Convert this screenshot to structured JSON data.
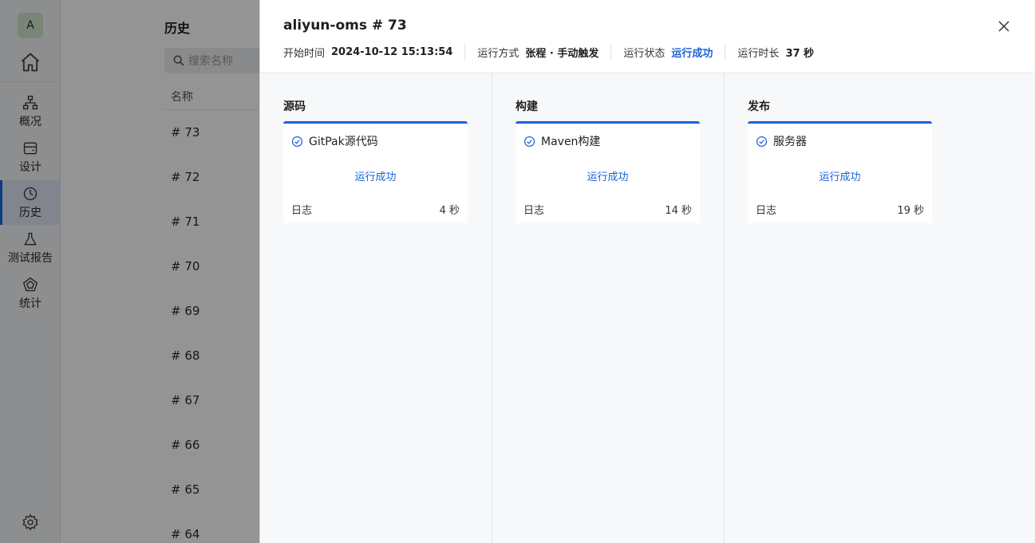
{
  "nav": {
    "avatar": "A",
    "items": [
      {
        "label": "概况",
        "icon": "sitemap-icon"
      },
      {
        "label": "设计",
        "icon": "card-icon"
      },
      {
        "label": "历史",
        "icon": "clock-icon"
      },
      {
        "label": "测试报告",
        "icon": "flask-icon"
      },
      {
        "label": "统计",
        "icon": "pentagon-icon"
      }
    ]
  },
  "list": {
    "title": "历史",
    "search_placeholder": "搜索名称",
    "column": "名称",
    "rows": [
      "# 73",
      "# 72",
      "# 71",
      "# 70",
      "# 69",
      "# 68",
      "# 67",
      "# 66",
      "# 65",
      "# 64"
    ]
  },
  "drawer": {
    "title": "aliyun-oms # 73",
    "meta": {
      "start_label": "开始时间",
      "start_value": "2024-10-12 15:13:54",
      "mode_label": "运行方式",
      "mode_value": "张程 · 手动触发",
      "status_label": "运行状态",
      "status_value": "运行成功",
      "duration_label": "运行时长",
      "duration_value": "37 秒"
    },
    "stages": [
      {
        "title": "源码",
        "task": "GitPak源代码",
        "status": "运行成功",
        "log": "日志",
        "duration": "4 秒"
      },
      {
        "title": "构建",
        "task": "Maven构建",
        "status": "运行成功",
        "log": "日志",
        "duration": "14 秒"
      },
      {
        "title": "发布",
        "task": "服务器",
        "status": "运行成功",
        "log": "日志",
        "duration": "19 秒"
      }
    ]
  },
  "colors": {
    "accent": "#1a63d6",
    "overlay": "rgba(0,0,0,0.42)"
  }
}
